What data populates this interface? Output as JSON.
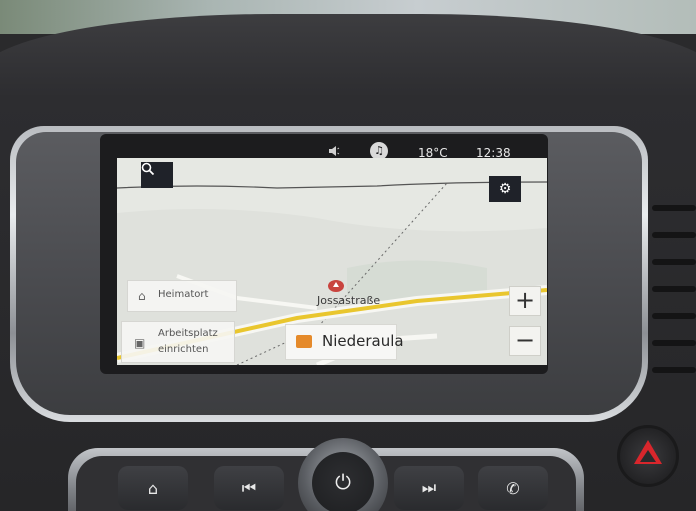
{
  "status_bar": {
    "speaker_icon": "speaker-icon",
    "media_icon": "music-note-icon",
    "temperature": "18°C",
    "time": "12:38"
  },
  "map": {
    "street_name": "Jossastraße",
    "place_name": "Niederaula",
    "shortcuts": {
      "home_label": "Heimatort",
      "work_label_line1": "Arbeitsplatz",
      "work_label_line2": "einrichten"
    },
    "zoom_in_label": "+",
    "zoom_out_label": "−"
  },
  "icons": {
    "search": "search-icon",
    "settings": "gear-icon",
    "home": "home-icon",
    "work": "briefcase-icon",
    "position": "position-arrow-icon"
  },
  "hardware_buttons": {
    "home": "home-icon",
    "previous": "skip-previous-icon",
    "power": "power-icon",
    "next": "skip-next-icon",
    "phone": "phone-icon",
    "hazard": "hazard-icon"
  },
  "colors": {
    "road_main": "#e9c62e",
    "road_secondary": "#f7f7f3",
    "map_background": "#dfe1dc",
    "hazard_red": "#d8262c",
    "position_marker": "#c9443f"
  }
}
